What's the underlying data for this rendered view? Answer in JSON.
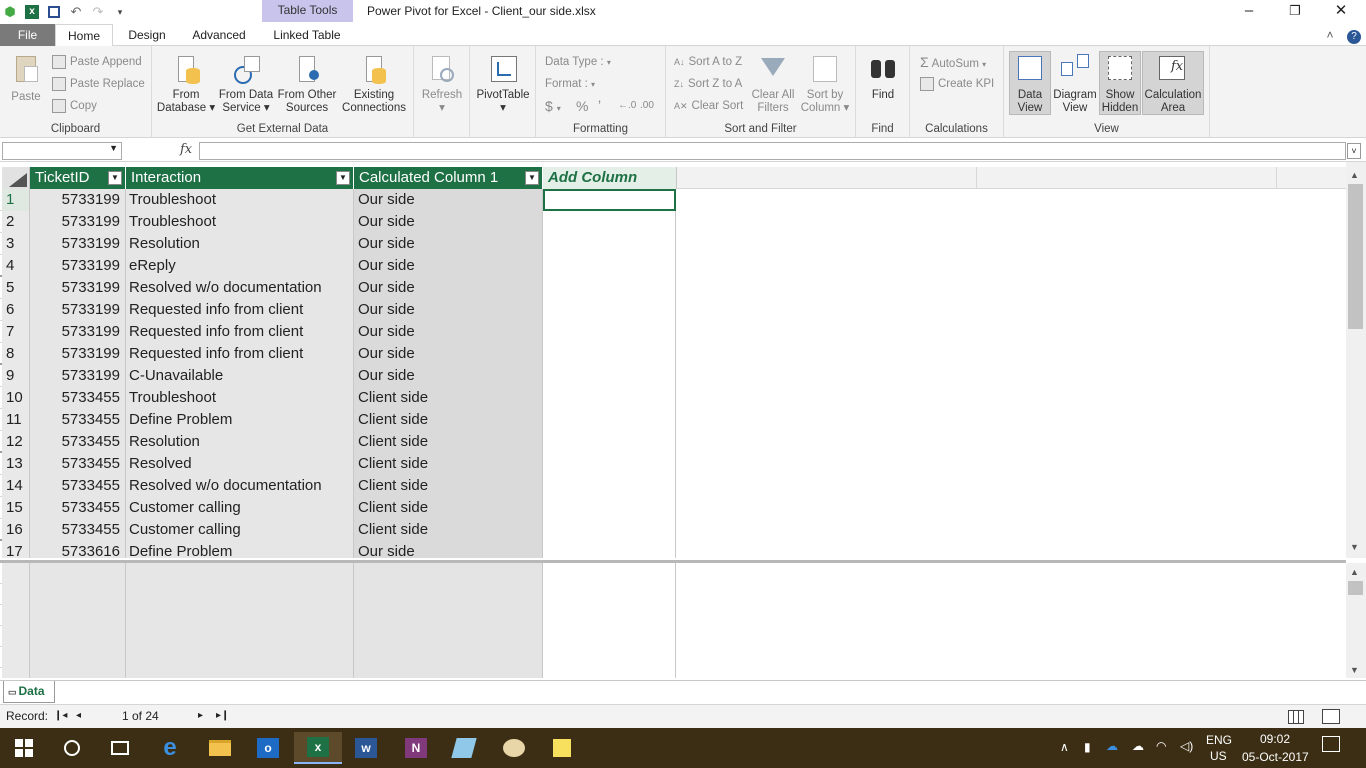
{
  "window": {
    "title": "Power Pivot for Excel - Client_our side.xlsx",
    "context_tab": "Table Tools"
  },
  "ribbon_tabs": [
    "File",
    "Home",
    "Design",
    "Advanced",
    "Linked Table"
  ],
  "ribbon": {
    "clipboard": {
      "paste": "Paste",
      "paste_append": "Paste Append",
      "paste_replace": "Paste Replace",
      "copy": "Copy",
      "label": "Clipboard"
    },
    "external": {
      "from_database_1": "From",
      "from_database_2": "Database",
      "from_service_1": "From Data",
      "from_service_2": "Service",
      "from_other_1": "From Other",
      "from_other_2": "Sources",
      "existing_1": "Existing",
      "existing_2": "Connections",
      "label": "Get External Data"
    },
    "refresh": "Refresh",
    "pivottable": "PivotTable",
    "formatting": {
      "data_type": "Data Type :",
      "format": "Format :",
      "currency": "$",
      "percent": "%",
      "comma": "ʼ",
      "label": "Formatting"
    },
    "sort": {
      "sort_az": "Sort A to Z",
      "sort_za": "Sort Z to A",
      "clear_sort": "Clear Sort",
      "clear_filters_1": "Clear All",
      "clear_filters_2": "Filters",
      "sort_by_1": "Sort by",
      "sort_by_2": "Column",
      "label": "Sort and Filter"
    },
    "find": {
      "button": "Find",
      "label": "Find"
    },
    "calculations": {
      "autosum": "AutoSum",
      "create_kpi": "Create KPI",
      "label": "Calculations"
    },
    "view": {
      "data_1": "Data",
      "data_2": "View",
      "diagram_1": "Diagram",
      "diagram_2": "View",
      "hidden_1": "Show",
      "hidden_2": "Hidden",
      "calc_1": "Calculation",
      "calc_2": "Area",
      "label": "View"
    }
  },
  "formula_bar": {
    "fx": "fx",
    "value": ""
  },
  "table": {
    "headers": [
      "TicketID",
      "Interaction",
      "Calculated Column 1",
      "Add Column"
    ],
    "rows": [
      {
        "n": "1",
        "id": "5733199",
        "interaction": "Troubleshoot",
        "calc": "Our side"
      },
      {
        "n": "2",
        "id": "5733199",
        "interaction": "Troubleshoot",
        "calc": "Our side"
      },
      {
        "n": "3",
        "id": "5733199",
        "interaction": "Resolution",
        "calc": "Our side"
      },
      {
        "n": "4",
        "id": "5733199",
        "interaction": "eReply",
        "calc": "Our side"
      },
      {
        "n": "5",
        "id": "5733199",
        "interaction": "Resolved w/o documentation",
        "calc": "Our side"
      },
      {
        "n": "6",
        "id": "5733199",
        "interaction": "Requested info from client",
        "calc": "Our side"
      },
      {
        "n": "7",
        "id": "5733199",
        "interaction": "Requested info from client",
        "calc": "Our side"
      },
      {
        "n": "8",
        "id": "5733199",
        "interaction": "Requested info from client",
        "calc": "Our side"
      },
      {
        "n": "9",
        "id": "5733199",
        "interaction": "C-Unavailable",
        "calc": "Our side"
      },
      {
        "n": "10",
        "id": "5733455",
        "interaction": "Troubleshoot",
        "calc": "Client side"
      },
      {
        "n": "11",
        "id": "5733455",
        "interaction": "Define Problem",
        "calc": "Client side"
      },
      {
        "n": "12",
        "id": "5733455",
        "interaction": "Resolution",
        "calc": "Client side"
      },
      {
        "n": "13",
        "id": "5733455",
        "interaction": "Resolved",
        "calc": "Client side"
      },
      {
        "n": "14",
        "id": "5733455",
        "interaction": "Resolved w/o documentation",
        "calc": "Client side"
      },
      {
        "n": "15",
        "id": "5733455",
        "interaction": "Customer calling",
        "calc": "Client side"
      },
      {
        "n": "16",
        "id": "5733455",
        "interaction": "Customer calling",
        "calc": "Client side"
      },
      {
        "n": "17",
        "id": "5733616",
        "interaction": "Define Problem",
        "calc": "Our side"
      }
    ]
  },
  "sheet_tab": "Data",
  "status": {
    "record_label": "Record:",
    "record_value": "1 of 24"
  },
  "taskbar": {
    "lang": "ENG",
    "region": "US",
    "time": "09:02",
    "date": "05-Oct-2017"
  },
  "colors": {
    "header_green": "#1e7145",
    "context_purple": "#c9c4ec",
    "taskbar_bg": "#3b2e14"
  }
}
